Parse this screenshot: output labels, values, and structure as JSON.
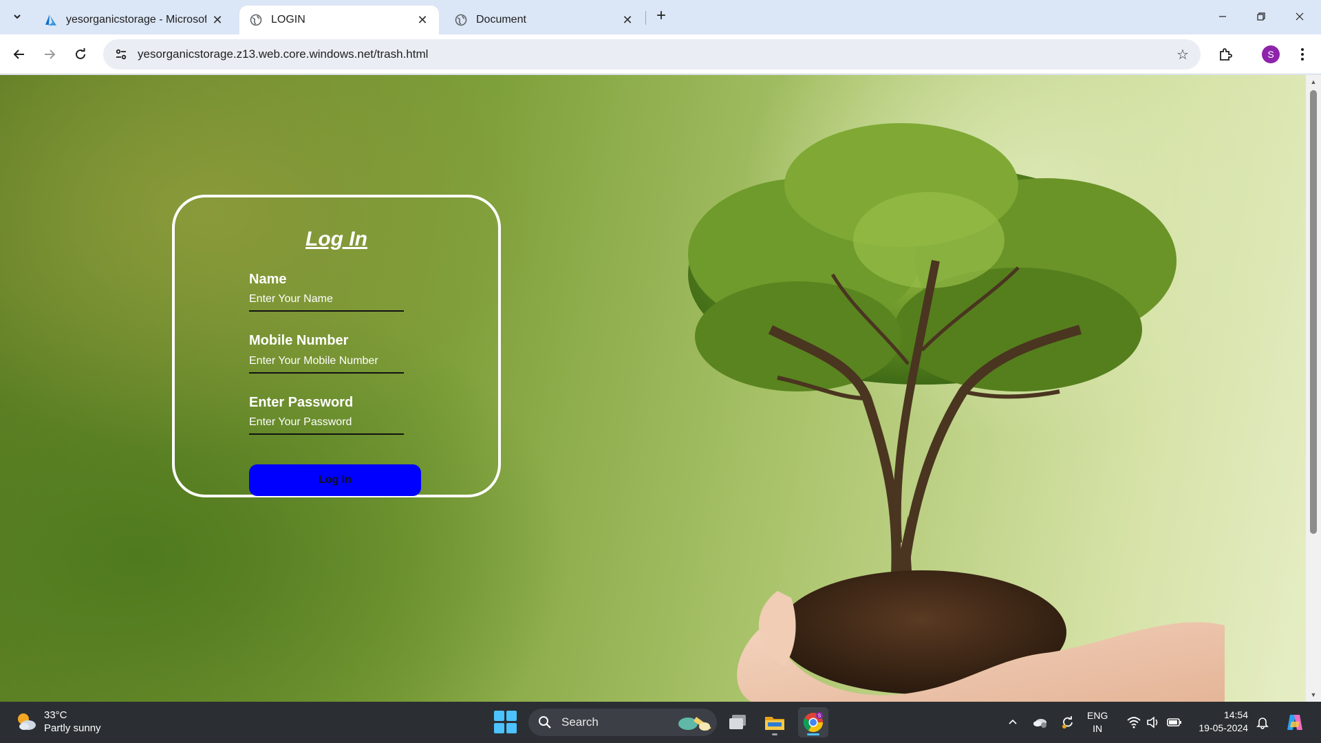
{
  "browser": {
    "tabs": [
      {
        "title": "yesorganicstorage - Microsoft A",
        "favicon": "azure-icon",
        "active": false
      },
      {
        "title": "LOGIN",
        "favicon": "globe-icon",
        "active": true
      },
      {
        "title": "Document",
        "favicon": "globe-icon",
        "active": false
      }
    ],
    "url": "yesorganicstorage.z13.web.core.windows.net/trash.html",
    "profile_initial": "S"
  },
  "login": {
    "title": "Log In",
    "name_label": "Name",
    "name_placeholder": "Enter Your Name",
    "mobile_label": "Mobile Number",
    "mobile_placeholder": "Enter Your Mobile Number",
    "password_label": "Enter Password",
    "password_placeholder": "Enter Your Password",
    "button_label": "Log In",
    "button_color": "#0000ff"
  },
  "taskbar": {
    "weather_temp": "33°C",
    "weather_desc": "Partly sunny",
    "search_placeholder": "Search",
    "lang_top": "ENG",
    "lang_bottom": "IN",
    "time": "14:54",
    "date": "19-05-2024",
    "accent": "#4cc2ff"
  }
}
